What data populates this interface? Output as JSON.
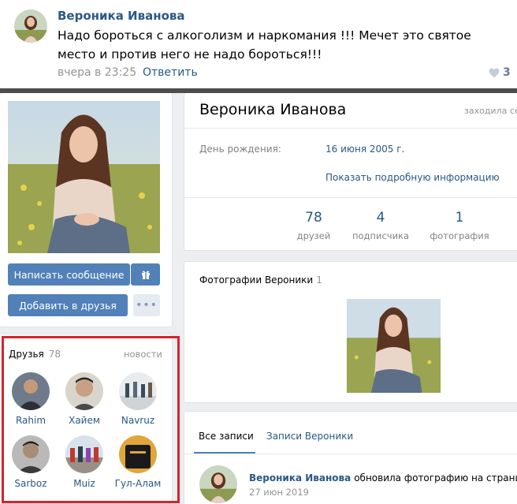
{
  "comment": {
    "author": "Вероника Иванова",
    "text": "Надо бороться с алкоголизм и наркомания !!! Мечет это святое место и против него не надо бороться!!!",
    "date": "вчера в 23:25",
    "reply_label": "Ответить",
    "likes": "3"
  },
  "profile": {
    "name": "Вероника Иванова",
    "status": "заходила се",
    "birthday_label": "День рождения:",
    "birthday_value": "16 июня 2005 г.",
    "more_info_label": "Показать подробную информацию",
    "counters": [
      {
        "value": "78",
        "label": "друзей"
      },
      {
        "value": "4",
        "label": "подписчика"
      },
      {
        "value": "1",
        "label": "фотография"
      }
    ],
    "buttons": {
      "message_label": "Написать сообщение",
      "add_friend_label": "Добавить в друзья",
      "more_label": "•••"
    }
  },
  "photos": {
    "title": "Фотографии Вероники",
    "count": "1"
  },
  "wall": {
    "tab_all": "Все записи",
    "tab_own": "Записи Вероники",
    "post_author": "Вероника Иванова",
    "post_text": "обновила фотографию на странице:",
    "post_date": "27 июн 2019"
  },
  "friends": {
    "title": "Друзья",
    "count": "78",
    "news_label": "новости",
    "items": [
      {
        "name": "Rahim"
      },
      {
        "name": "Хайем"
      },
      {
        "name": "Navruz"
      },
      {
        "name": "Sarboz"
      },
      {
        "name": "Muiz"
      },
      {
        "name": "Гул-Алам"
      }
    ]
  },
  "colors": {
    "accent": "#5181b8",
    "link": "#2a5885",
    "highlight": "#d6242b"
  },
  "icons": [
    "heart-icon",
    "gift-icon"
  ]
}
